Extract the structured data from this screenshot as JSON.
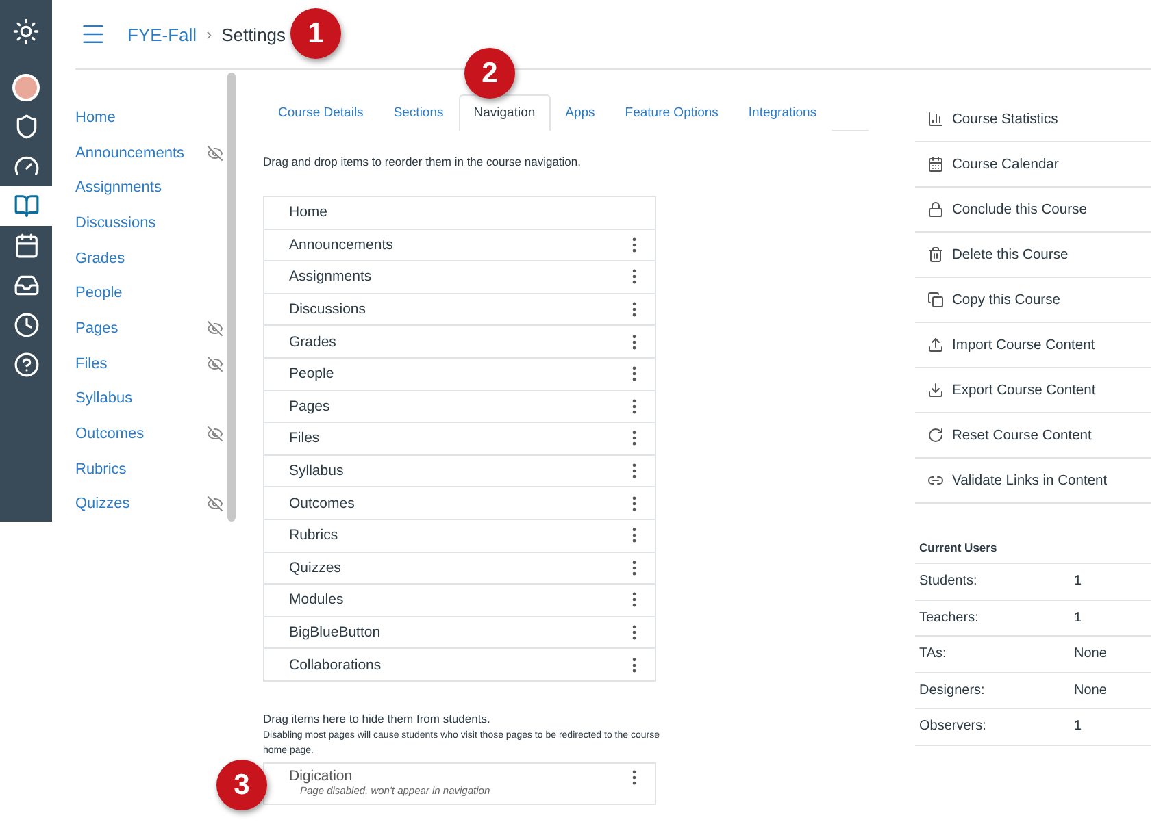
{
  "global_nav": [
    {
      "kind": "logo",
      "selected": false
    },
    {
      "kind": "avatar",
      "selected": false
    },
    {
      "kind": "admin",
      "selected": false
    },
    {
      "kind": "dashboard",
      "selected": false
    },
    {
      "kind": "courses",
      "selected": true
    },
    {
      "kind": "calendar",
      "selected": false
    },
    {
      "kind": "inbox",
      "selected": false
    },
    {
      "kind": "history",
      "selected": false
    },
    {
      "kind": "help",
      "selected": false
    }
  ],
  "breadcrumb": {
    "course": "FYE-Fall",
    "separator": "›",
    "page": "Settings"
  },
  "course_nav": [
    {
      "label": "Home",
      "hidden": false
    },
    {
      "label": "Announcements",
      "hidden": true
    },
    {
      "label": "Assignments",
      "hidden": false
    },
    {
      "label": "Discussions",
      "hidden": false
    },
    {
      "label": "Grades",
      "hidden": false
    },
    {
      "label": "People",
      "hidden": false
    },
    {
      "label": "Pages",
      "hidden": true
    },
    {
      "label": "Files",
      "hidden": true
    },
    {
      "label": "Syllabus",
      "hidden": false
    },
    {
      "label": "Outcomes",
      "hidden": true
    },
    {
      "label": "Rubrics",
      "hidden": false
    },
    {
      "label": "Quizzes",
      "hidden": true
    }
  ],
  "tabs": [
    {
      "label": "Course Details",
      "selected": false
    },
    {
      "label": "Sections",
      "selected": false
    },
    {
      "label": "Navigation",
      "selected": true
    },
    {
      "label": "Apps",
      "selected": false
    },
    {
      "label": "Feature Options",
      "selected": false
    },
    {
      "label": "Integrations",
      "selected": false
    }
  ],
  "instructions": "Drag and drop items to reorder them in the course navigation.",
  "nav_items": [
    {
      "label": "Home",
      "menu": false
    },
    {
      "label": "Announcements",
      "menu": true
    },
    {
      "label": "Assignments",
      "menu": true
    },
    {
      "label": "Discussions",
      "menu": true
    },
    {
      "label": "Grades",
      "menu": true
    },
    {
      "label": "People",
      "menu": true
    },
    {
      "label": "Pages",
      "menu": true
    },
    {
      "label": "Files",
      "menu": true
    },
    {
      "label": "Syllabus",
      "menu": true
    },
    {
      "label": "Outcomes",
      "menu": true
    },
    {
      "label": "Rubrics",
      "menu": true
    },
    {
      "label": "Quizzes",
      "menu": true
    },
    {
      "label": "Modules",
      "menu": true
    },
    {
      "label": "BigBlueButton",
      "menu": true
    },
    {
      "label": "Collaborations",
      "menu": true
    }
  ],
  "hidden_section": {
    "heading": "Drag items here to hide them from students.",
    "note": "Disabling most pages will cause students who visit those pages to be redirected to the course home page.",
    "items": [
      {
        "label": "Digication",
        "status": "Page disabled, won't appear in navigation",
        "menu": true
      }
    ]
  },
  "sidebar_actions": [
    {
      "label": "Course Statistics"
    },
    {
      "label": "Course Calendar"
    },
    {
      "label": "Conclude this Course"
    },
    {
      "label": "Delete this Course"
    },
    {
      "label": "Copy this Course"
    },
    {
      "label": "Import Course Content"
    },
    {
      "label": "Export Course Content"
    },
    {
      "label": "Reset Course Content"
    },
    {
      "label": "Validate Links in Content"
    }
  ],
  "current_users": {
    "title": "Current Users",
    "rows": [
      {
        "role": "Students:",
        "count": "1"
      },
      {
        "role": "Teachers:",
        "count": "1"
      },
      {
        "role": "TAs:",
        "count": "None"
      },
      {
        "role": "Designers:",
        "count": "None"
      },
      {
        "role": "Observers:",
        "count": "1"
      }
    ]
  },
  "callouts": [
    {
      "number": "1"
    },
    {
      "number": "2"
    },
    {
      "number": "3"
    }
  ]
}
